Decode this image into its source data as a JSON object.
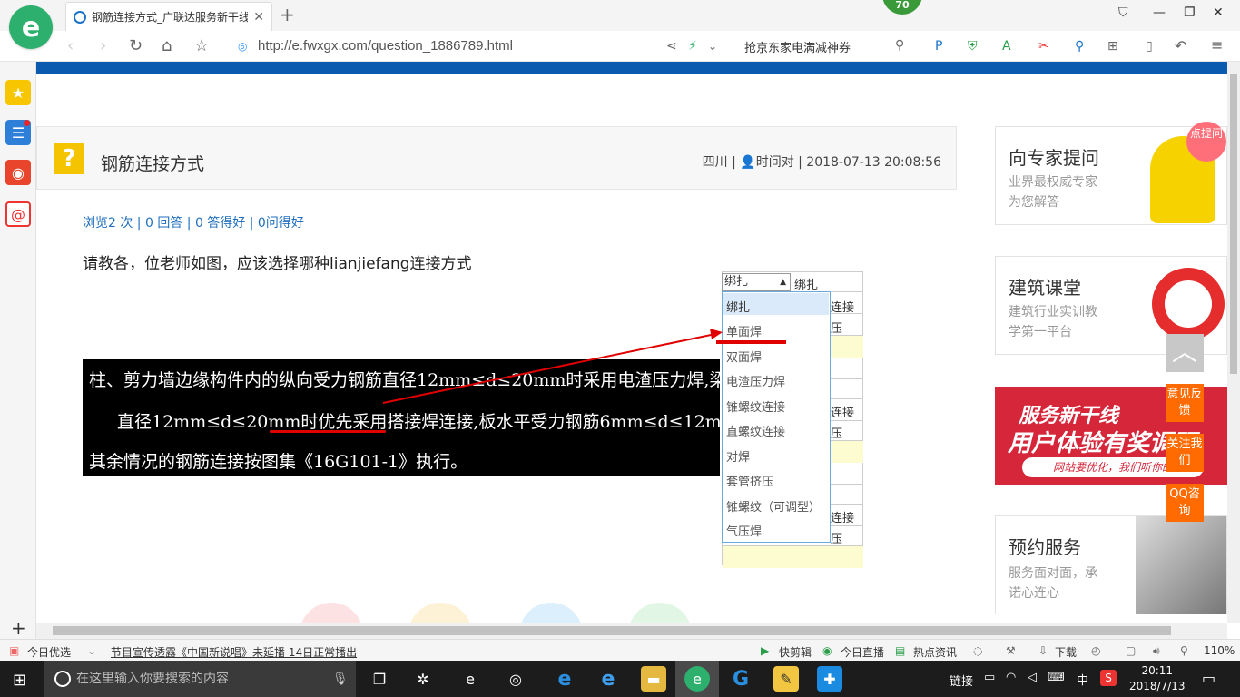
{
  "browser": {
    "tab_title": "钢筋连接方式_广联达服务新干线",
    "url": "http://e.fwxgx.com/question_1886789.html",
    "search_text": "抢京东家电满减神券",
    "badge_count": "70",
    "notification_count": "2"
  },
  "question": {
    "title": "钢筋连接方式",
    "meta": "四川 | 👤时间对 | 2018-07-13 20:08:56",
    "stats": "浏览2 次 | 0 回答 | 0 答得好 | 0问得好",
    "body": "请教各，位老师如图，应该选择哪种lianjiefang连接方式",
    "image_lines": [
      "柱、剪力墙边缘构件内的纵向受力钢筋直径12mm≤d≤20mm时采用电渣压力焊,梁水平受力钢筋",
      "直径12mm≤d≤20mm时优先采用搭接焊连接,板水平受力钢筋6mm≤d≤12mm时优先采用绑扎连接。",
      "其余情况的钢筋连接按图集《16G101-1》执行。"
    ]
  },
  "dropdown": {
    "selected": "绑扎",
    "col2_header": "绑扎",
    "options": [
      "绑扎",
      "单面焊",
      "双面焊",
      "电渣压力焊",
      "锥螺纹连接",
      "直螺纹连接",
      "对焊",
      "套管挤压",
      "锥螺纹（可调型）",
      "气压焊"
    ],
    "right_cells": [
      "连接",
      "压",
      "连接",
      "压",
      "连接",
      "压"
    ]
  },
  "right": {
    "card1_title": "向专家提问",
    "card1_sub1": "业界最权威专家",
    "card1_sub2": "为您解答",
    "card1_bubble": "点提问",
    "card2_title": "建筑课堂",
    "card2_sub1": "建筑行业实训教",
    "card2_sub2": "学第一平台",
    "banner_line1": "服务新干线",
    "banner_line2": "用户体验有奖调研",
    "banner_line3": "网站要优化，我们听你的",
    "card3_title": "预约服务",
    "card3_sub1": "服务面对面，承",
    "card3_sub2": "诺心连心",
    "float_feedback": "意见反馈",
    "float_follow": "关注我们",
    "float_qq": "QQ咨询"
  },
  "statusbar": {
    "left1": "今日优选",
    "news": "节目宣传透露《中国新说唱》未延播 14日正常播出",
    "r1": "快剪辑",
    "r2": "今日直播",
    "r3": "热点资讯",
    "r4": "下载",
    "zoom": "110%"
  },
  "taskbar": {
    "search_placeholder": "在这里输入你要搜索的内容",
    "tray_text": "链接",
    "ime": "中",
    "time": "20:11",
    "date": "2018/7/13"
  }
}
